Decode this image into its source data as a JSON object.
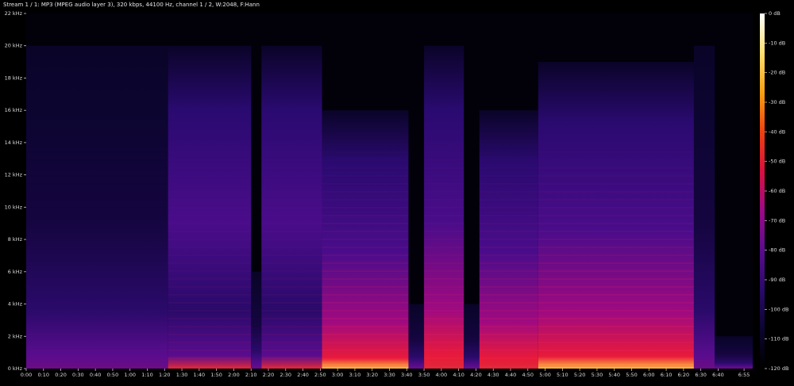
{
  "title": "Stream 1 / 1: MP3 (MPEG audio layer 3), 320 kbps, 44100 Hz, channel 1 / 2, W:2048, F:Hann",
  "chart_data": {
    "type": "heatmap",
    "title": "Stream 1 / 1: MP3 (MPEG audio layer 3), 320 kbps, 44100 Hz, channel 1 / 2, W:2048, F:Hann",
    "x_ticks": [
      "0:00",
      "0:10",
      "0:20",
      "0:30",
      "0:40",
      "0:50",
      "1:00",
      "1:10",
      "1:20",
      "1:30",
      "1:40",
      "1:50",
      "2:00",
      "2:10",
      "2:20",
      "2:30",
      "2:40",
      "2:50",
      "3:00",
      "3:10",
      "3:20",
      "3:30",
      "3:40",
      "3:50",
      "4:00",
      "4:10",
      "4:20",
      "4:30",
      "4:40",
      "4:50",
      "5:00",
      "5:10",
      "5:20",
      "5:30",
      "5:40",
      "5:50",
      "6:00",
      "6:10",
      "6:20",
      "6:30",
      "6:40",
      "6:55"
    ],
    "x_seconds": [
      0,
      10,
      20,
      30,
      40,
      50,
      60,
      70,
      80,
      90,
      100,
      110,
      120,
      130,
      140,
      150,
      160,
      170,
      180,
      190,
      200,
      210,
      220,
      230,
      240,
      250,
      260,
      270,
      280,
      290,
      300,
      310,
      320,
      330,
      340,
      350,
      360,
      370,
      380,
      390,
      400,
      415
    ],
    "xlim": [
      0,
      420
    ],
    "y_ticks": [
      "0 kHz",
      "2 kHz",
      "4 kHz",
      "6 kHz",
      "8 kHz",
      "10 kHz",
      "12 kHz",
      "14 kHz",
      "16 kHz",
      "18 kHz",
      "20 kHz",
      "22 kHz"
    ],
    "y_khz": [
      0,
      2,
      4,
      6,
      8,
      10,
      12,
      14,
      16,
      18,
      20,
      22
    ],
    "ylim": [
      0,
      22
    ],
    "colorbar_ticks": [
      "0 dB",
      "-10 dB",
      "-20 dB",
      "-30 dB",
      "-40 dB",
      "-50 dB",
      "-60 dB",
      "-70 dB",
      "-80 dB",
      "-90 dB",
      "-100 dB",
      "-110 dB",
      "-120 dB"
    ],
    "colorbar_db": [
      0,
      -10,
      -20,
      -30,
      -40,
      -50,
      -60,
      -70,
      -80,
      -90,
      -100,
      -110,
      -120
    ],
    "colorbar_range": [
      -120,
      0
    ],
    "colors": [
      "#000000",
      "#0c0530",
      "#2a0a6a",
      "#5a0c8e",
      "#9a0a86",
      "#d81040",
      "#f04010",
      "#f8a010",
      "#ffe070",
      "#ffffff"
    ],
    "segments": [
      {
        "start": 0,
        "end": 82,
        "level": 0.35,
        "cutoff_khz": 20
      },
      {
        "start": 82,
        "end": 130,
        "level": 0.55,
        "cutoff_khz": 20
      },
      {
        "start": 130,
        "end": 136,
        "level": 0.25,
        "cutoff_khz": 6
      },
      {
        "start": 136,
        "end": 171,
        "level": 0.55,
        "cutoff_khz": 20
      },
      {
        "start": 171,
        "end": 221,
        "level": 0.9,
        "cutoff_khz": 16
      },
      {
        "start": 221,
        "end": 230,
        "level": 0.2,
        "cutoff_khz": 4
      },
      {
        "start": 230,
        "end": 253,
        "level": 0.7,
        "cutoff_khz": 20
      },
      {
        "start": 253,
        "end": 262,
        "level": 0.25,
        "cutoff_khz": 4
      },
      {
        "start": 262,
        "end": 296,
        "level": 0.8,
        "cutoff_khz": 16
      },
      {
        "start": 296,
        "end": 386,
        "level": 0.95,
        "cutoff_khz": 19
      },
      {
        "start": 386,
        "end": 398,
        "level": 0.1,
        "cutoff_khz": 20
      },
      {
        "start": 398,
        "end": 420,
        "level": 0.05,
        "cutoff_khz": 2
      }
    ]
  }
}
